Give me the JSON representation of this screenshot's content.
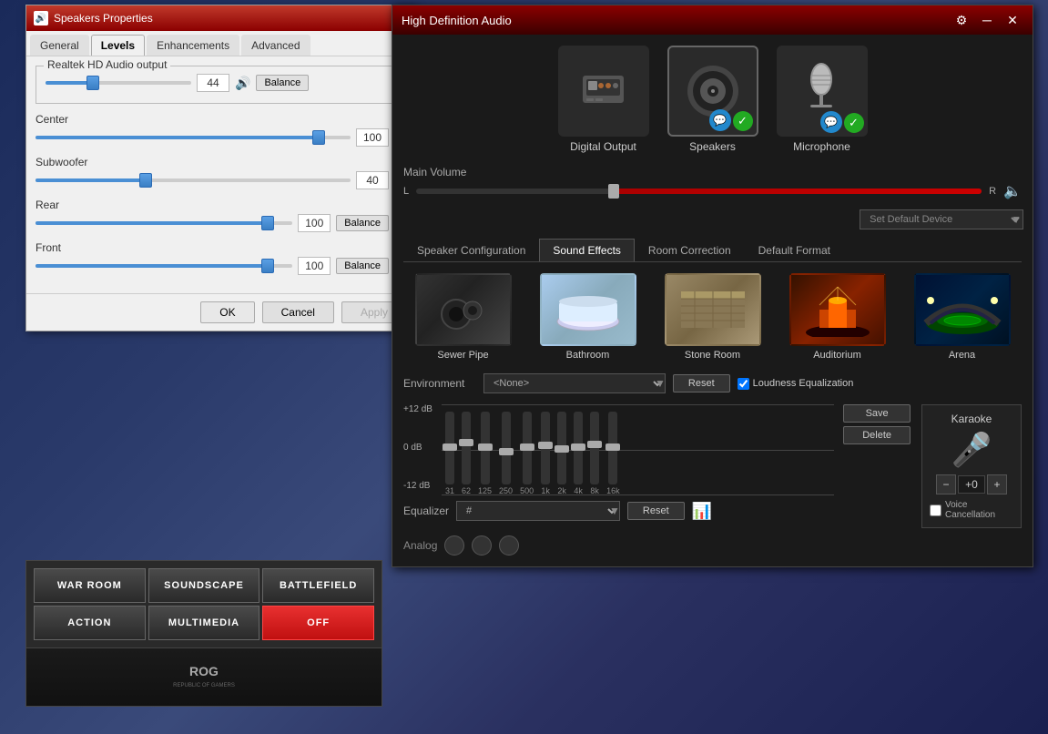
{
  "speakers_window": {
    "title": "Speakers Properties",
    "tabs": [
      "General",
      "Levels",
      "Enhancements",
      "Advanced"
    ],
    "active_tab": "Levels",
    "realtek_label": "Realtek HD Audio output",
    "realtek_value": "44",
    "center_label": "Center",
    "center_value": "100",
    "subwoofer_label": "Subwoofer",
    "subwoofer_value": "40",
    "rear_label": "Rear",
    "rear_value": "100",
    "front_label": "Front",
    "front_value": "100",
    "ok_btn": "OK",
    "cancel_btn": "Cancel",
    "apply_btn": "Apply"
  },
  "rog_panel": {
    "buttons": [
      "WAR ROOM",
      "SOUNDSCAPE",
      "BATTLEFIELD",
      "ACTION",
      "MULTIMEDIA",
      "OFF"
    ],
    "logo_text": "REPUBLIC OF\nGAMERS"
  },
  "hda_window": {
    "title": "High Definition Audio",
    "devices": [
      {
        "name": "Digital Output",
        "selected": false
      },
      {
        "name": "Speakers",
        "selected": true
      },
      {
        "name": "Microphone",
        "selected": false
      }
    ],
    "main_volume_label": "Main Volume",
    "vol_l": "L",
    "vol_r": "R",
    "default_device_placeholder": "Set Default Device",
    "tabs": [
      "Speaker Configuration",
      "Sound Effects",
      "Room Correction",
      "Default Format"
    ],
    "active_tab": "Sound Effects",
    "effects": [
      {
        "name": "Sewer Pipe",
        "type": "sewer"
      },
      {
        "name": "Bathroom",
        "type": "bathroom"
      },
      {
        "name": "Stone Room",
        "type": "stone"
      },
      {
        "name": "Auditorium",
        "type": "auditorium"
      },
      {
        "name": "Arena",
        "type": "arena"
      }
    ],
    "environment_label": "Environment",
    "environment_value": "<None>",
    "reset_btn": "Reset",
    "loudness_label": "Loudness Equalization",
    "eq_labels": {
      "+12 dB": 0,
      "0 dB": 50,
      "-12 dB": 100
    },
    "eq_plus12": "+12 dB",
    "eq_0": "0 dB",
    "eq_minus12": "-12 dB",
    "eq_freqs": [
      "31",
      "62",
      "125",
      "250",
      "500",
      "1k",
      "2k",
      "4k",
      "8k",
      "16k"
    ],
    "eq_positions": [
      50,
      45,
      50,
      55,
      50,
      48,
      52,
      50,
      47,
      50
    ],
    "equalizer_label": "Equalizer",
    "equalizer_value": "#",
    "eq_reset_btn": "Reset",
    "save_btn": "Save",
    "delete_btn": "Delete",
    "karaoke_label": "Karaoke",
    "karaoke_value": "+0",
    "karaoke_minus": "−",
    "karaoke_plus": "+",
    "voice_cancel_label": "Voice Cancellation",
    "analog_label": "Analog"
  }
}
